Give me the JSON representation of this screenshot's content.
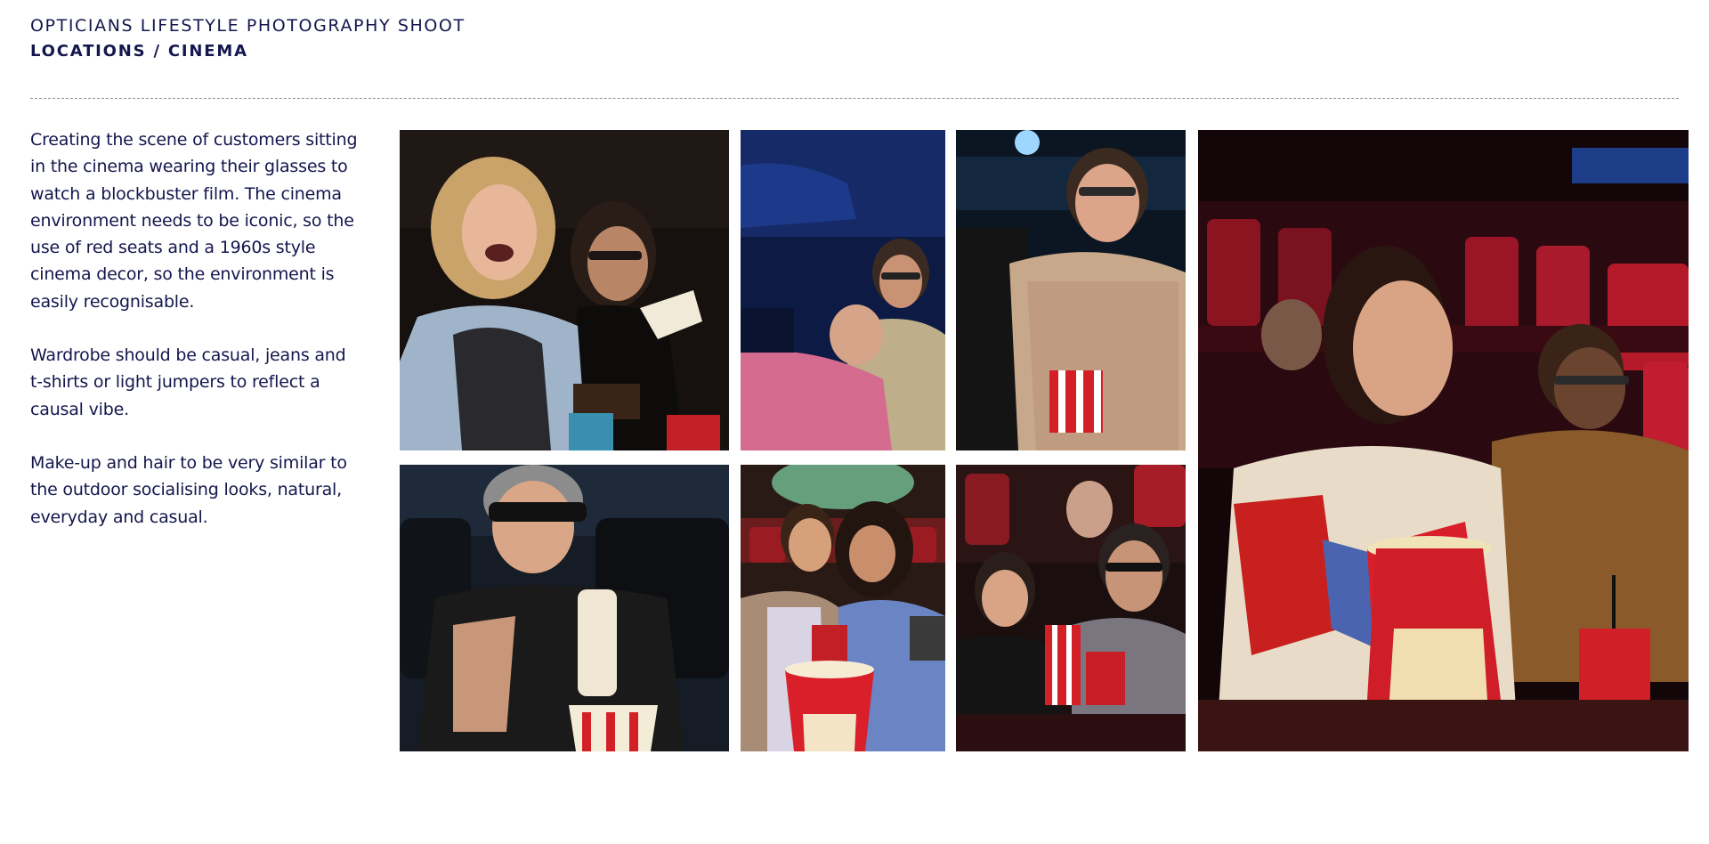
{
  "header": {
    "eyebrow": "OPTICIANS LIFESTYLE PHOTOGRAPHY SHOOT",
    "title": "LOCATIONS / CINEMA"
  },
  "copy": {
    "p1": "Creating the scene of customers sitting in the cinema wearing their glasses to watch a blockbuster film. The cinema environment needs to be iconic, so the use of red seats and a 1960s style cinema decor, so the environment is easily recognisable.",
    "p2": "Wardrobe should be casual, jeans and t-shirts or light jumpers to reflect a causal vibe.",
    "p3": "Make-up and hair to be very similar to the outdoor socialising looks, natural, everyday and casual."
  },
  "photos": [
    {
      "name": "laughing-women-popcorn-photo"
    },
    {
      "name": "couple-lying-seats-photo"
    },
    {
      "name": "man-eating-popcorn-glasses-photo"
    },
    {
      "name": "woman-smiling-red-seats-photo"
    },
    {
      "name": "man-3d-glasses-drinking-photo"
    },
    {
      "name": "couple-popcorn-laughing-photo"
    },
    {
      "name": "surprised-audience-photo"
    }
  ],
  "colors": {
    "navy": "#14164d",
    "seat_red": "#b51a2a",
    "popcorn_red": "#d81f2a",
    "dark": "#120d0d"
  }
}
